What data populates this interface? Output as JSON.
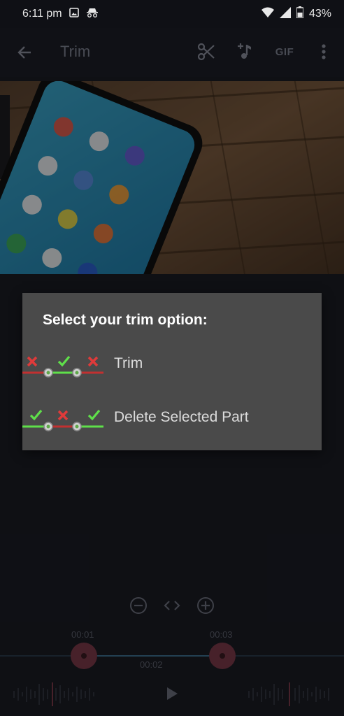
{
  "status_bar": {
    "time": "6:11 pm",
    "battery": "43%"
  },
  "app_bar": {
    "title": "Trim",
    "gif_label": "GIF"
  },
  "dialog": {
    "title": "Select your trim option:",
    "options": [
      {
        "label": "Trim"
      },
      {
        "label": "Delete Selected Part"
      }
    ]
  },
  "timeline": {
    "start_time": "00:01",
    "end_time": "00:03",
    "duration": "00:02"
  },
  "colors": {
    "accent": "#c0566b",
    "check": "#5fe04a",
    "cross": "#e03a3a"
  }
}
